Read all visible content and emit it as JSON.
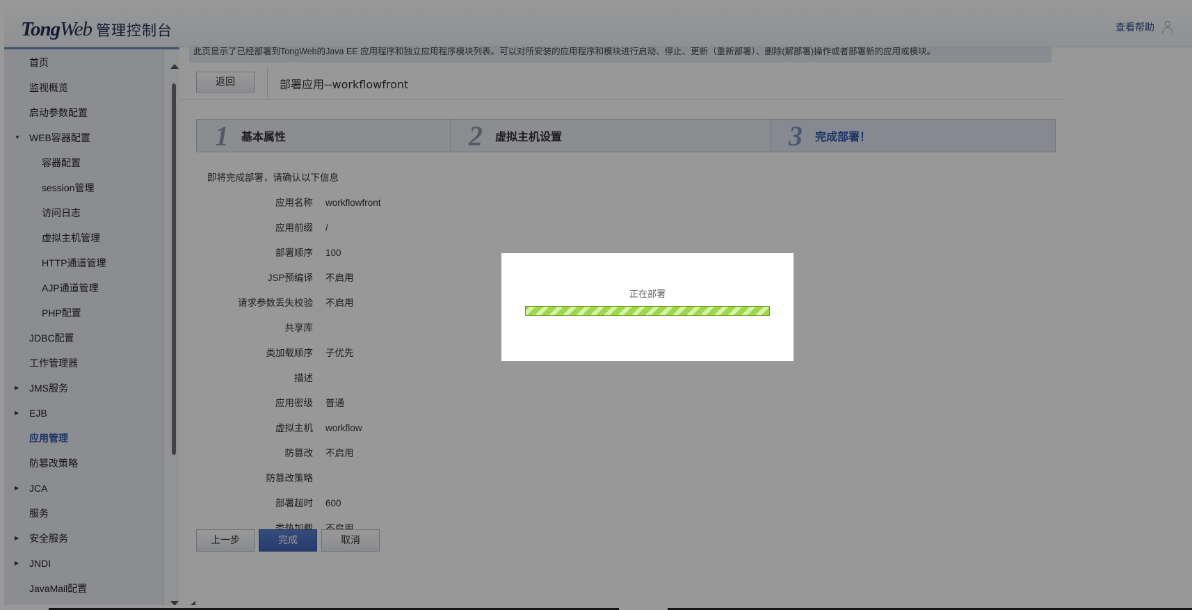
{
  "header": {
    "logo_tong": "Tong",
    "logo_web": "Web",
    "logo_cn": "管理控制台",
    "help_label": "查看帮助"
  },
  "sidebar": {
    "items": [
      {
        "label": "首页",
        "level": 1,
        "expandable": false
      },
      {
        "label": "监视概览",
        "level": 1,
        "expandable": false
      },
      {
        "label": "启动参数配置",
        "level": 1,
        "expandable": false
      },
      {
        "label": "WEB容器配置",
        "level": 1,
        "expandable": true,
        "expanded": true
      },
      {
        "label": "容器配置",
        "level": 2,
        "expandable": false
      },
      {
        "label": "session管理",
        "level": 2,
        "expandable": false
      },
      {
        "label": "访问日志",
        "level": 2,
        "expandable": false
      },
      {
        "label": "虚拟主机管理",
        "level": 2,
        "expandable": false
      },
      {
        "label": "HTTP通道管理",
        "level": 2,
        "expandable": false
      },
      {
        "label": "AJP通道管理",
        "level": 2,
        "expandable": false
      },
      {
        "label": "PHP配置",
        "level": 2,
        "expandable": false
      },
      {
        "label": "JDBC配置",
        "level": 1,
        "expandable": false
      },
      {
        "label": "工作管理器",
        "level": 1,
        "expandable": false
      },
      {
        "label": "JMS服务",
        "level": 1,
        "expandable": true,
        "expanded": false
      },
      {
        "label": "EJB",
        "level": 1,
        "expandable": true,
        "expanded": false
      },
      {
        "label": "应用管理",
        "level": 1,
        "expandable": false,
        "active": true
      },
      {
        "label": "防篡改策略",
        "level": 1,
        "expandable": false
      },
      {
        "label": "JCA",
        "level": 1,
        "expandable": true,
        "expanded": false
      },
      {
        "label": "服务",
        "level": 1,
        "expandable": false
      },
      {
        "label": "安全服务",
        "level": 1,
        "expandable": true,
        "expanded": false
      },
      {
        "label": "JNDI",
        "level": 1,
        "expandable": true,
        "expanded": false
      },
      {
        "label": "JavaMail配置",
        "level": 1,
        "expandable": false
      }
    ]
  },
  "main": {
    "info_text": "此页显示了已经部署到TongWeb的Java EE 应用程序和独立应用程序模块列表。可以对所安装的应用程序和模块进行启动、停止、更新（重新部署）、删除(解部署)操作或者部署新的应用或模块。",
    "back_button": "返回",
    "page_title": "部署应用--workflowfront",
    "steps": [
      {
        "num": "1",
        "label": "基本属性",
        "current": false
      },
      {
        "num": "2",
        "label": "虚拟主机设置",
        "current": false
      },
      {
        "num": "3",
        "label": "完成部署！",
        "current": true
      }
    ],
    "confirm_intro": "即将完成部署，请确认以下信息",
    "fields": [
      {
        "label": "应用名称",
        "value": "workflowfront"
      },
      {
        "label": "应用前缀",
        "value": "/"
      },
      {
        "label": "部署顺序",
        "value": "100"
      },
      {
        "label": "JSP预编译",
        "value": "不启用"
      },
      {
        "label": "请求参数丢失校验",
        "value": "不启用"
      },
      {
        "label": "共享库",
        "value": ""
      },
      {
        "label": "类加载顺序",
        "value": "子优先"
      },
      {
        "label": "描述",
        "value": ""
      },
      {
        "label": "应用密级",
        "value": "普通"
      },
      {
        "label": "虚拟主机",
        "value": "workflow"
      },
      {
        "label": "防篡改",
        "value": "不启用"
      },
      {
        "label": "防篡改策略",
        "value": ""
      },
      {
        "label": "部署超时",
        "value": "600"
      },
      {
        "label": "类热加载",
        "value": "不启用"
      }
    ],
    "buttons": {
      "prev": "上一步",
      "finish": "完成",
      "cancel": "取消"
    }
  },
  "dialog": {
    "message": "正在部署",
    "progress": 1.0,
    "progress_color": "#9bd94a"
  },
  "colors": {
    "accent": "#2d55a8",
    "primary_button": "#4a70c0"
  }
}
